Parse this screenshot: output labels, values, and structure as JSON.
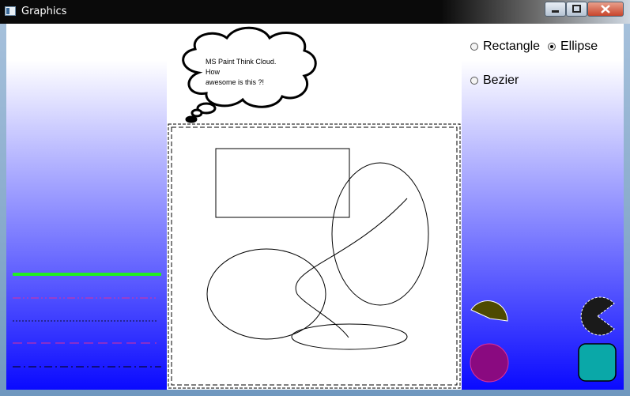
{
  "window": {
    "title": "Graphics",
    "minimize_label": "▭",
    "maximize_label": "□",
    "close_label": "✕"
  },
  "cloud": {
    "line1": "MS Paint Think Cloud.",
    "line2": "How",
    "line3": "awesome is this ?!"
  },
  "shape_options": {
    "rectangle_label": "Rectangle",
    "ellipse_label": "Ellipse",
    "bezier_label": "Bezier",
    "selected": "Ellipse"
  },
  "line_styles": [
    {
      "name": "solid",
      "color": "#22ee22"
    },
    {
      "name": "dash-dot-dot",
      "color": "#e0309a"
    },
    {
      "name": "dotted",
      "color": "#101030"
    },
    {
      "name": "dashed",
      "color": "#e0309a"
    },
    {
      "name": "dash-dot",
      "color": "#000000"
    }
  ],
  "fill_swatches": [
    {
      "name": "pie-olive",
      "color": "#4e4a00"
    },
    {
      "name": "pacman-black",
      "color": "#1a1a1a"
    },
    {
      "name": "circle-purple",
      "color": "#8a0a80"
    },
    {
      "name": "rounded-square-teal",
      "color": "#0aa8a8"
    }
  ],
  "colors": {
    "gradient_top": "#ffffff",
    "gradient_bottom": "#0a0aff"
  }
}
